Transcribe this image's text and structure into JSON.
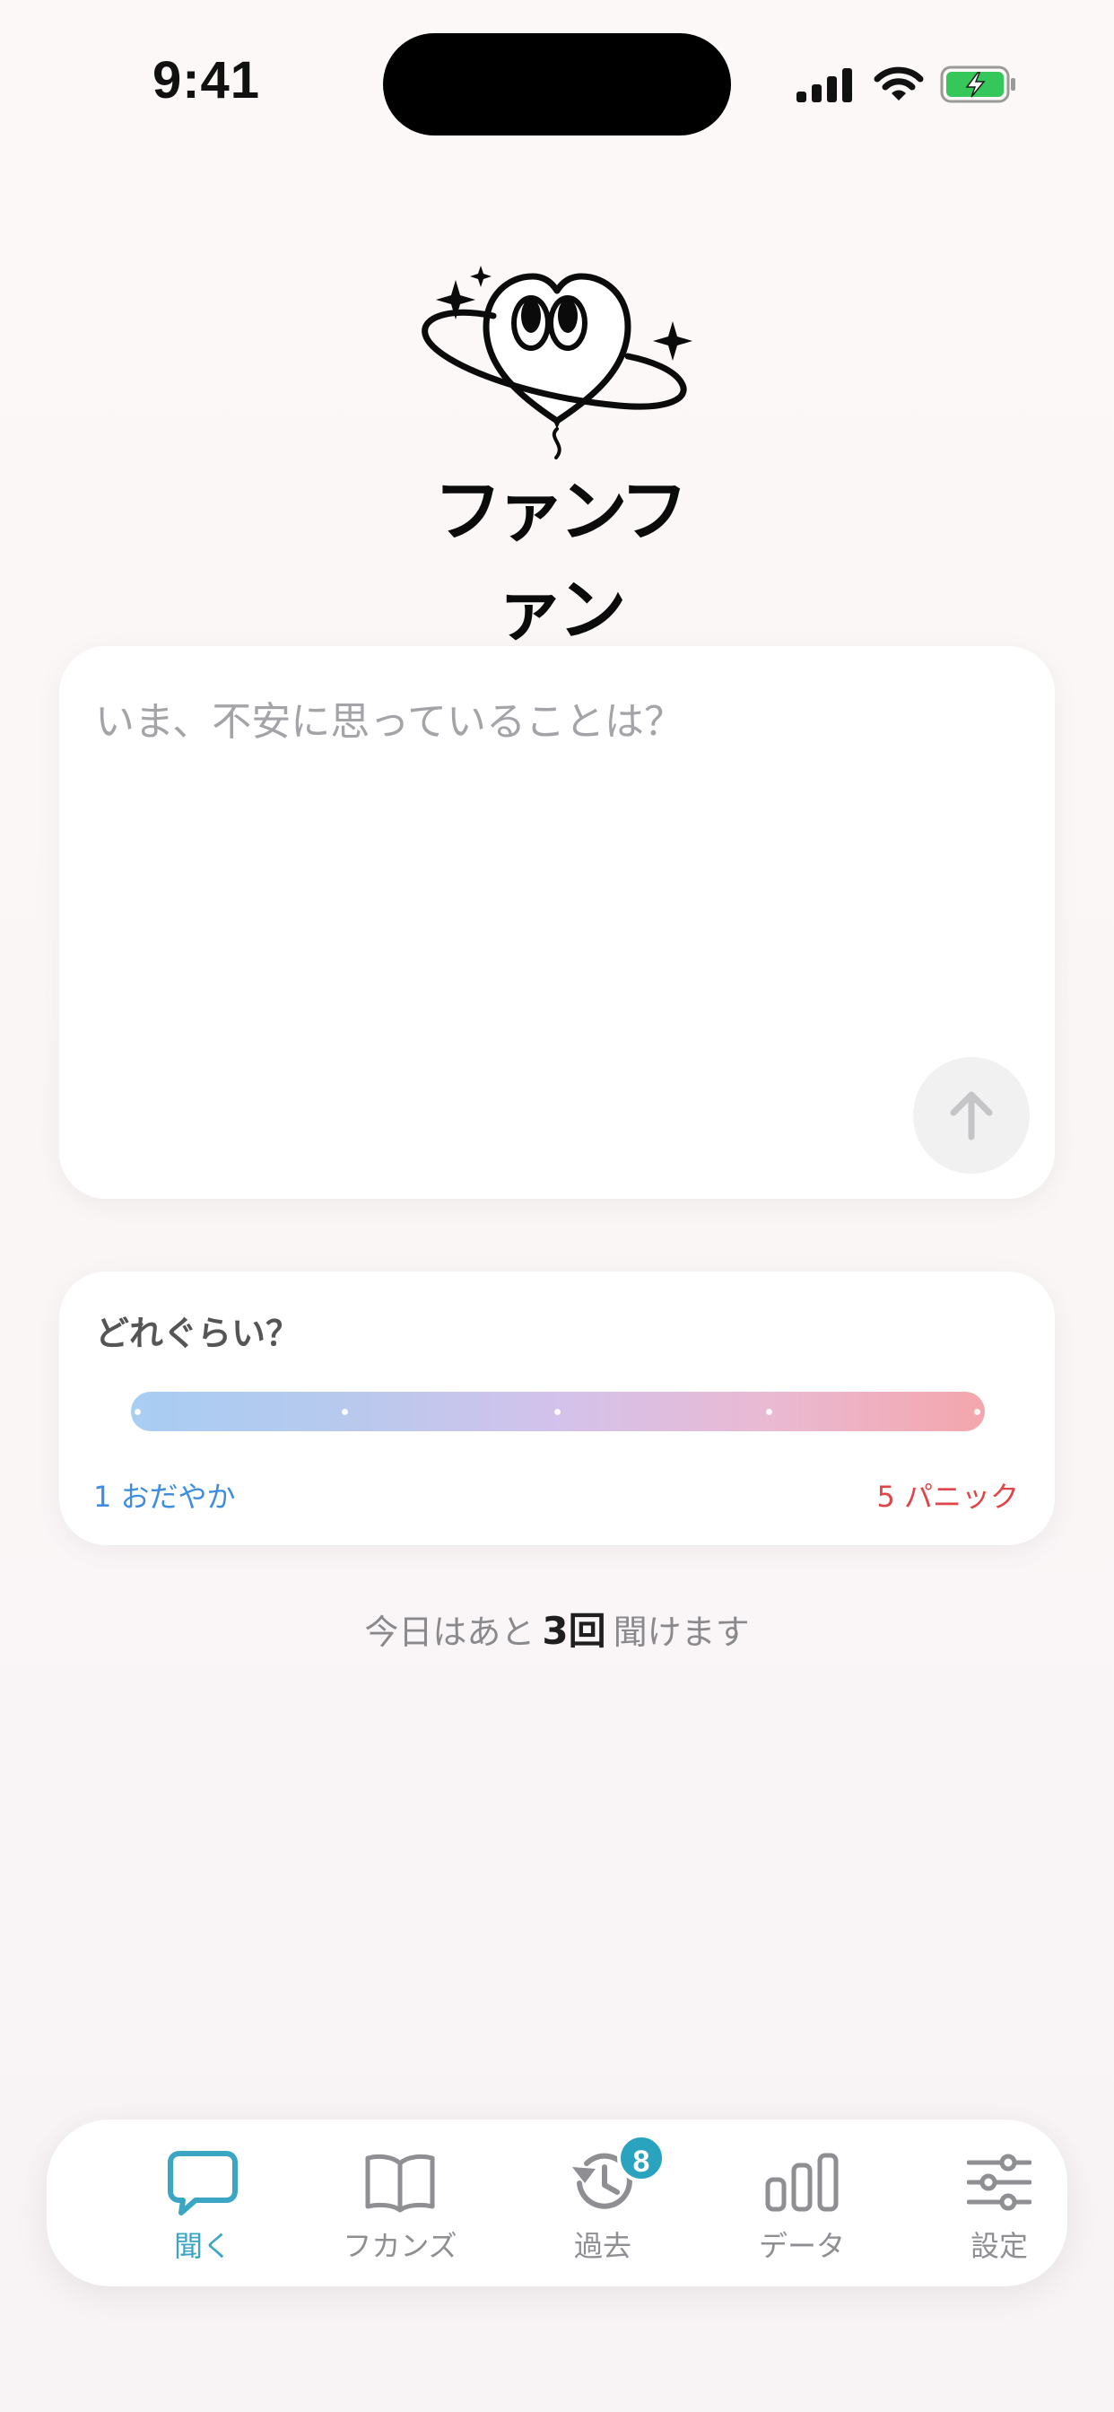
{
  "status_bar": {
    "time": "9:41"
  },
  "logo": {
    "text": "ファンファン"
  },
  "input": {
    "placeholder": "いま、不安に思っていることは？",
    "value": ""
  },
  "level": {
    "title": "どれぐらい？",
    "min_label": "1 おだやか",
    "max_label": "5 パニック",
    "steps": 5
  },
  "remaining": {
    "prefix": "今日はあと",
    "count": "3回",
    "suffix": "聞けます"
  },
  "tabs": [
    {
      "label": "聞く",
      "icon": "chat-bubble-icon",
      "active": true
    },
    {
      "label": "フカンズ",
      "icon": "book-icon",
      "active": false
    },
    {
      "label": "過去",
      "icon": "history-icon",
      "active": false,
      "badge": "8"
    },
    {
      "label": "データ",
      "icon": "bar-chart-icon",
      "active": false
    },
    {
      "label": "設定",
      "icon": "sliders-icon",
      "active": false
    }
  ],
  "colors": {
    "accent": "#3aa6c3",
    "calm": "#3d8ee0",
    "panic": "#e0454a"
  }
}
